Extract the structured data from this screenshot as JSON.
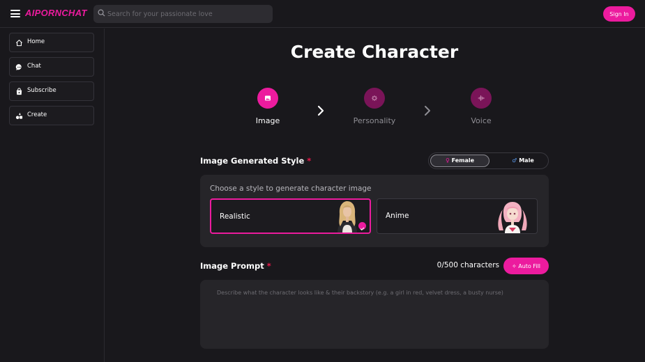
{
  "header": {
    "logo": "AIPORNCHAT",
    "search_placeholder": "Search for your passionate love",
    "signin_label": "Sign In"
  },
  "sidebar": {
    "items": [
      {
        "label": "Home",
        "icon": "home-icon"
      },
      {
        "label": "Chat",
        "icon": "chat-icon"
      },
      {
        "label": "Subscribe",
        "icon": "bag-icon"
      },
      {
        "label": "Create",
        "icon": "create-icon"
      }
    ]
  },
  "main": {
    "title": "Create Character",
    "steps": [
      {
        "label": "Image",
        "active": true,
        "icon": "image-icon"
      },
      {
        "label": "Personality",
        "active": false,
        "icon": "brain-icon"
      },
      {
        "label": "Voice",
        "active": false,
        "icon": "waveform-icon"
      }
    ],
    "image_style": {
      "label": "Image Generated Style",
      "required_mark": "*",
      "gender_options": [
        {
          "label": "Female",
          "selected": true,
          "icon": "venus-icon"
        },
        {
          "label": "Male",
          "selected": false,
          "icon": "mars-icon"
        }
      ],
      "caption": "Choose a style to generate character image",
      "styles": [
        {
          "label": "Realistic",
          "selected": true
        },
        {
          "label": "Anime",
          "selected": false
        }
      ]
    },
    "prompt": {
      "label": "Image Prompt",
      "required_mark": "*",
      "char_count": "0/500 characters",
      "autofill_label": "Auto Fill",
      "placeholder": "Describe what the character looks like & their backstory (e.g. a girl in red, velvet dress, a busty nurse)"
    }
  },
  "colors": {
    "accent": "#ec1b9e",
    "background": "#19181c",
    "panel": "#262529",
    "step_inactive": "#7a1458"
  }
}
